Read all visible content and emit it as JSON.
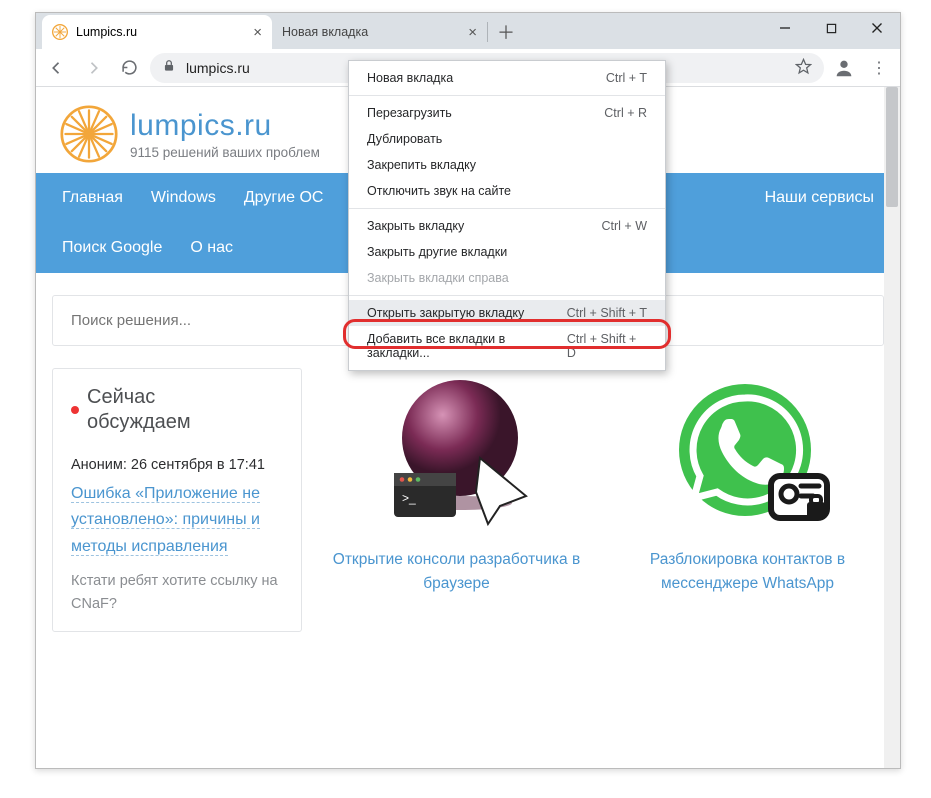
{
  "tabs": {
    "active": {
      "title": "Lumpics.ru"
    },
    "inactive": {
      "title": "Новая вкладка"
    }
  },
  "omnibox": {
    "url": "lumpics.ru"
  },
  "site": {
    "brand": "lumpics.ru",
    "tagline": "9115 решений ваших проблем"
  },
  "nav": {
    "home": "Главная",
    "windows": "Windows",
    "other_os": "Другие ОС",
    "services": "Наши сервисы",
    "google": "Поиск Google",
    "about": "О нас"
  },
  "search": {
    "placeholder": "Поиск решения..."
  },
  "sidebar": {
    "title_l1": "Сейчас",
    "title_l2": "обсуждаем",
    "meta": "Аноним: 26 сентября в 17:41",
    "link": "Ошибка «Приложение не установлено»: причины и методы исправления",
    "note": "Кстати ребят хотите ссылку на CNaF?"
  },
  "cards": {
    "c1": "Открытие консоли разработчика в браузере",
    "c2": "Разблокировка контактов в мессенджере WhatsApp"
  },
  "context_menu": {
    "new_tab": {
      "label": "Новая вкладка",
      "shortcut": "Ctrl + T"
    },
    "reload": {
      "label": "Перезагрузить",
      "shortcut": "Ctrl + R"
    },
    "duplicate": {
      "label": "Дублировать",
      "shortcut": ""
    },
    "pin": {
      "label": "Закрепить вкладку",
      "shortcut": ""
    },
    "mute": {
      "label": "Отключить звук на сайте",
      "shortcut": ""
    },
    "close_tab": {
      "label": "Закрыть вкладку",
      "shortcut": "Ctrl + W"
    },
    "close_other": {
      "label": "Закрыть другие вкладки",
      "shortcut": ""
    },
    "close_right": {
      "label": "Закрыть вкладки справа",
      "shortcut": ""
    },
    "reopen": {
      "label": "Открыть закрытую вкладку",
      "shortcut": "Ctrl + Shift + T"
    },
    "bookmark_all": {
      "label": "Добавить все вкладки в закладки...",
      "shortcut": "Ctrl + Shift + D"
    }
  }
}
